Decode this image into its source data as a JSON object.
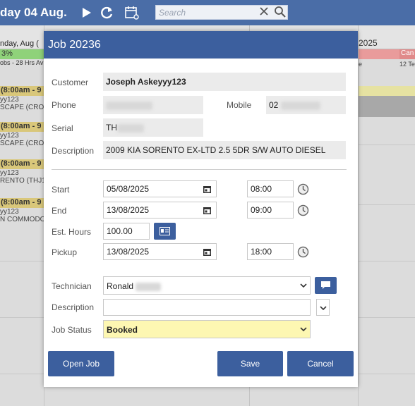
{
  "app": {
    "date_title": "day 04 Aug.",
    "search_placeholder": "Search",
    "col_header_left": "nday, Aug (",
    "col_header_right": "2025",
    "utilization_pct": "3%",
    "utilization_sub": "obs - 28 Hrs Av",
    "right_col_sub_1": "e",
    "right_col_sub_2": "12 Te",
    "right_col_bar_2": "Can",
    "events": [
      {
        "time": "(8:00am - 9",
        "lines": [
          "yy123",
          "SCAPE (CRO"
        ]
      },
      {
        "time": "(8:00am - 9",
        "lines": [
          "yy123",
          "SCAPE (CRO"
        ]
      },
      {
        "time": "(8:00am - 9",
        "lines": [
          "yy123",
          "RENTO (THJ1"
        ]
      },
      {
        "time": "(8:00am - 9",
        "lines": [
          "yy123",
          "N COMMODO"
        ]
      }
    ]
  },
  "dialog": {
    "title": "Job 20236",
    "customer_label": "Customer",
    "customer_value": "Joseph Askeyyy123",
    "phone_label": "Phone",
    "mobile_label": "Mobile",
    "mobile_value": "02",
    "serial_label": "Serial",
    "serial_value": "TH",
    "description_label": "Description",
    "description_value": "2009 KIA SORENTO EX-LTD 2.5 5DR S/W AUTO DIESEL",
    "start_label": "Start",
    "start_date": "05/08/2025",
    "start_time": "08:00",
    "end_label": "End",
    "end_date": "13/08/2025",
    "end_time": "09:00",
    "hours_label": "Est. Hours",
    "hours_value": "100.00",
    "pickup_label": "Pickup",
    "pickup_date": "13/08/2025",
    "pickup_time": "18:00",
    "technician_label": "Technician",
    "technician_value": "Ronald",
    "desc2_label": "Description",
    "desc2_value": "",
    "status_label": "Job Status",
    "status_value": "Booked",
    "open_job": "Open Job",
    "save": "Save",
    "cancel": "Cancel"
  },
  "colors": {
    "header_blue": "#3c5f9e",
    "status_yellow": "#fdf7b2",
    "utilization_green": "#8fd27a"
  }
}
